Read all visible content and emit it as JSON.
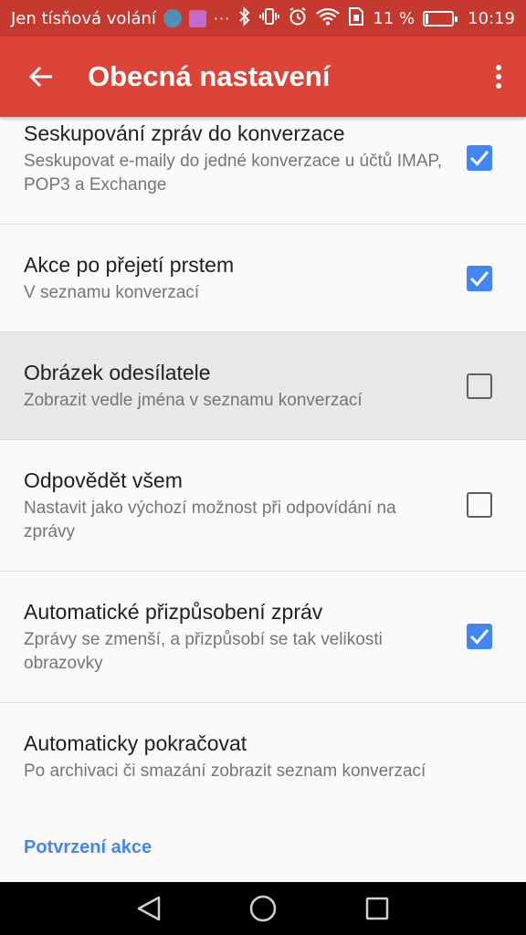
{
  "status_bar": {
    "notification_text": "Jen tísňová volání",
    "overflow": "···",
    "battery_percent": "11 %",
    "battery_level": 0.11,
    "time": "10:19",
    "icons": [
      "moon-app-icon",
      "gallery-app-icon",
      "bluetooth-icon",
      "vibrate-icon",
      "alarm-icon",
      "wifi-icon",
      "sim-icon",
      "battery-icon"
    ]
  },
  "app_bar": {
    "title": "Obecná nastavení",
    "back_icon": "arrow-back-icon",
    "menu_icon": "more-vert-icon"
  },
  "settings": [
    {
      "title": "Seskupování zpráv do konverzace",
      "summary": "Seskupovat e-maily do jedné konverzace u účtů IMAP, POP3 a Exchange",
      "checked": true
    },
    {
      "title": "Akce po přejetí prstem",
      "summary": "V seznamu konverzací",
      "checked": true
    },
    {
      "title": "Obrázek odesílatele",
      "summary": "Zobrazit vedle jména v seznamu konverzací",
      "checked": false
    },
    {
      "title": "Odpovědět všem",
      "summary": "Nastavit jako výchozí možnost při odpovídání na zprávy",
      "checked": false
    },
    {
      "title": "Automatické přizpůsobení zpráv",
      "summary": "Zprávy se zmenší, a přizpůsobí se tak velikosti obrazovky",
      "checked": true
    },
    {
      "title": "Automaticky pokračovat",
      "summary": "Po archivaci či smazání zobrazit seznam konverzací"
    }
  ],
  "section_header": "Potvrzení akce",
  "colors": {
    "status_bar": "#c6392f",
    "app_bar": "#db4437",
    "accent": "#4285f4",
    "background": "#fafafa",
    "highlight": "#e8e8e8"
  }
}
